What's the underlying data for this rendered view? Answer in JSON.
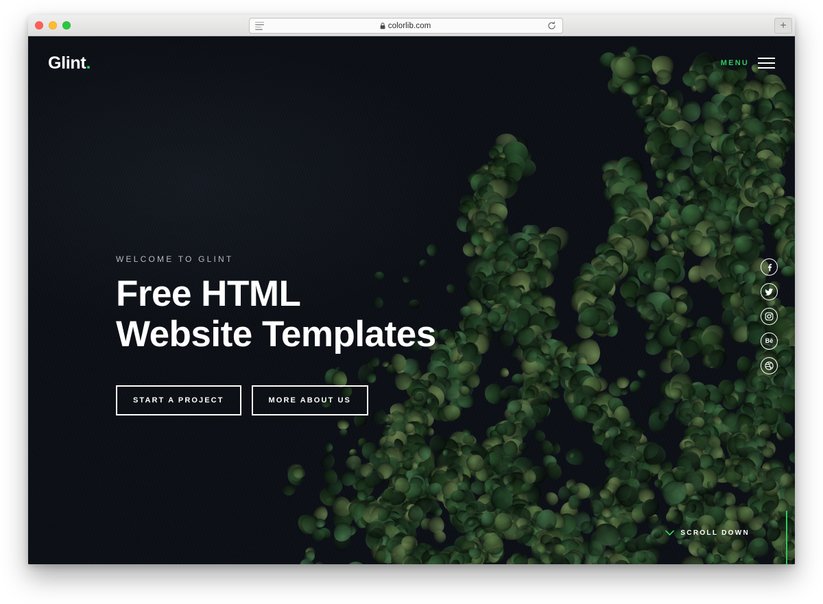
{
  "browser": {
    "traffic_lights": [
      {
        "name": "close",
        "color": "#ff5f57"
      },
      {
        "name": "minimize",
        "color": "#febc2e"
      },
      {
        "name": "maximize",
        "color": "#28c840"
      }
    ],
    "reader_icon": "reader-view-icon",
    "lock_icon": "lock-icon",
    "url": "colorlib.com",
    "reload_icon": "reload-icon",
    "new_tab_label": "+"
  },
  "site": {
    "header": {
      "logo_text": "Glint",
      "logo_dot": ".",
      "menu_label": "MENU",
      "menu_icon": "hamburger-icon"
    },
    "hero": {
      "eyebrow": "WELCOME TO GLINT",
      "heading_line_1": "Free HTML",
      "heading_line_2": "Website Templates",
      "buttons": [
        {
          "label": "START A PROJECT"
        },
        {
          "label": "MORE ABOUT US"
        }
      ]
    },
    "social": [
      {
        "name": "facebook",
        "glyph": "f"
      },
      {
        "name": "twitter",
        "glyph": "t"
      },
      {
        "name": "instagram",
        "glyph": "i"
      },
      {
        "name": "behance",
        "glyph": "Bē"
      },
      {
        "name": "dribbble",
        "glyph": "d"
      }
    ],
    "scroll": {
      "label": "SCROLL DOWN",
      "icon": "chevron-down-icon"
    }
  },
  "colors": {
    "accent_green": "#2ecc5e",
    "background_dark": "#0a0e13",
    "text_light": "#ffffff",
    "eyebrow_gray": "#b8bcc0"
  }
}
